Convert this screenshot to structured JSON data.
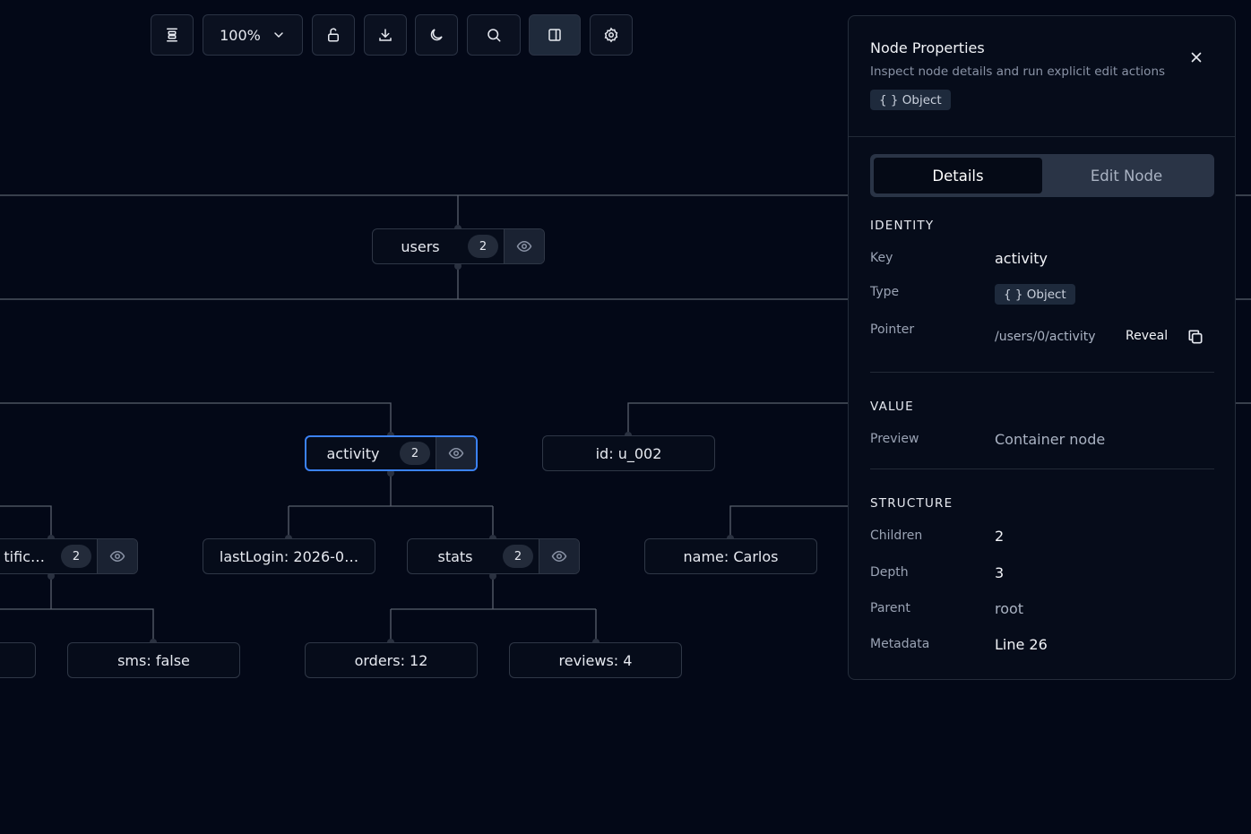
{
  "toolbar": {
    "zoom": "100%",
    "buttons": [
      "align-icon",
      "zoom-dropdown",
      "lock-icon",
      "download-icon",
      "moon-icon",
      "search-icon",
      "panel-toggle-icon",
      "gear-icon"
    ]
  },
  "graph": {
    "nodes": [
      {
        "label": "users",
        "count": "2"
      },
      {
        "label": "activity",
        "count": "2"
      },
      {
        "label": "id: u_002"
      },
      {
        "label": "tific…",
        "count": "2"
      },
      {
        "label": "lastLogin: 2026-0…"
      },
      {
        "label": "stats",
        "count": "2"
      },
      {
        "label": "name: Carlos"
      },
      {
        "label": "sms: false"
      },
      {
        "label": "orders: 12"
      },
      {
        "label": "reviews: 4"
      }
    ]
  },
  "panel": {
    "title": "Node Properties",
    "subtitle": "Inspect node details and run explicit edit actions",
    "type_chip": "{ } Object",
    "tabs": {
      "details": "Details",
      "edit": "Edit Node"
    },
    "identity": {
      "heading": "IDENTITY",
      "key_label": "Key",
      "key_value": "activity",
      "type_label": "Type",
      "type_value": "{ } Object",
      "pointer_label": "Pointer",
      "pointer_value": "/users/0/activity",
      "reveal": "Reveal"
    },
    "value": {
      "heading": "VALUE",
      "preview_label": "Preview",
      "preview_value": "Container node"
    },
    "structure": {
      "heading": "STRUCTURE",
      "children_label": "Children",
      "children_value": "2",
      "depth_label": "Depth",
      "depth_value": "3",
      "parent_label": "Parent",
      "parent_value": "root",
      "metadata_label": "Metadata",
      "metadata_value": "Line 26"
    }
  }
}
